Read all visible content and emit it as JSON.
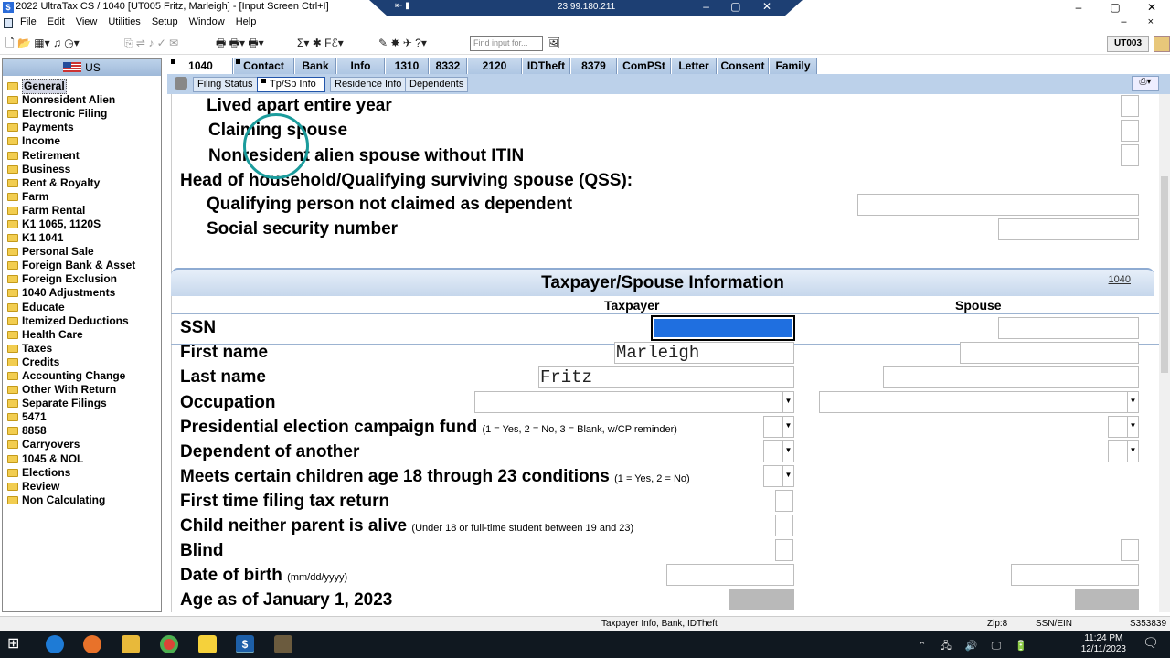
{
  "window": {
    "title": "2022 UltraTax CS  / 1040 [UT005 Fritz, Marleigh] - [Input Screen    Ctrl+I]",
    "app_icon": "$",
    "remote_ip": "23.99.180.211",
    "remote_left": "⇤ ▮",
    "remote_right": "– ▢ ✕",
    "controls": [
      "–",
      "▢",
      "✕"
    ]
  },
  "menu": {
    "items": [
      "File",
      "Edit",
      "View",
      "Utilities",
      "Setup",
      "Window",
      "Help"
    ],
    "mdi_controls": "– ×"
  },
  "toolbar": {
    "icons_left": "🗋 📂  ▦▾ ♫ ◷▾",
    "icons_mid": "⎘ ⇌  ♪ ✓ ✉",
    "icons_print": "🖶 🖶▾ 🖶▾",
    "icons_calc": "Σ▾ ✱ Fℰ▾",
    "icons_right": "✎ ✸   ✈ ?▾",
    "find_placeholder": "Find input for...",
    "find_icon": "🖼",
    "client_id": "UT003"
  },
  "sidebar": {
    "country": "US",
    "items": [
      "General",
      "Nonresident Alien",
      "Electronic Filing",
      "Payments",
      "Income",
      "Retirement",
      "Business",
      "Rent & Royalty",
      "Farm",
      "Farm Rental",
      "K1 1065, 1120S",
      "K1 1041",
      "Personal Sale",
      "Foreign Bank & Asset",
      "Foreign Exclusion",
      "1040 Adjustments",
      "Educate",
      "Itemized Deductions",
      "Health Care",
      "Taxes",
      "Credits",
      "Accounting Change",
      "Other With Return",
      "Separate Filings",
      "5471",
      "8858",
      "Carryovers",
      "1045 & NOL",
      "Elections",
      "Review",
      "Non Calculating"
    ],
    "selected": "General"
  },
  "tabs": [
    "1040",
    "Contact",
    "Bank",
    "Info",
    "1310",
    "8332",
    "2120",
    "IDTheft",
    "8379",
    "ComPSt",
    "Letter",
    "Consent",
    "Family"
  ],
  "subtabs": [
    "Filing Status",
    "Tp/Sp  Info",
    "Residence Info",
    "Dependents"
  ],
  "subtab_right_icon": "⎙▾",
  "form": {
    "upper_rows": {
      "lived_apart": "Lived apart entire year",
      "claiming_spouse": "Claiming spouse",
      "nonresident_no_itin": "Nonresident alien spouse without  ITIN",
      "hoh_heading": "Head of household/Qualifying surviving spouse (QSS):",
      "qualifying_not_claimed": "Qualifying person not claimed as dependent",
      "ssn_hoh": "Social security number"
    },
    "section_title": "Taxpayer/Spouse  Information",
    "section_link": "1040",
    "col_taxpayer": "Taxpayer",
    "col_spouse": "Spouse",
    "rows": {
      "ssn": "SSN",
      "first_name": "First name",
      "last_name": "Last name",
      "occupation": "Occupation",
      "pecf": "Presidential election campaign fund",
      "pecf_note": "(1 = Yes, 2 = No, 3 = Blank, w/CP reminder)",
      "dependent_of_another": "Dependent of another",
      "children_18_23": "Meets certain children age 18 through 23 conditions",
      "children_note": "(1 = Yes, 2 = No)",
      "first_time": "First time filing tax return",
      "child_neither_parent": "Child neither parent is alive",
      "child_note": "(Under 18 or full-time student between 19 and 23)",
      "blind": "Blind",
      "dob": "Date of birth",
      "dob_note": "(mm/dd/yyyy)",
      "age": "Age as of January 1, 2023"
    },
    "values": {
      "tp_first_name": "Marleigh",
      "tp_last_name": "Fritz"
    },
    "dropdown_arrow": "▼"
  },
  "status": {
    "center": "Taxpayer Info, Bank, IDTheft",
    "zip": "Zip:8",
    "ssn_ein": "SSN/EIN",
    "code": "S353839"
  },
  "taskbar": {
    "time": "11:24 PM",
    "date": "12/11/2023",
    "tray": "⌃ 🖧 🔊 🖵 🔋"
  }
}
